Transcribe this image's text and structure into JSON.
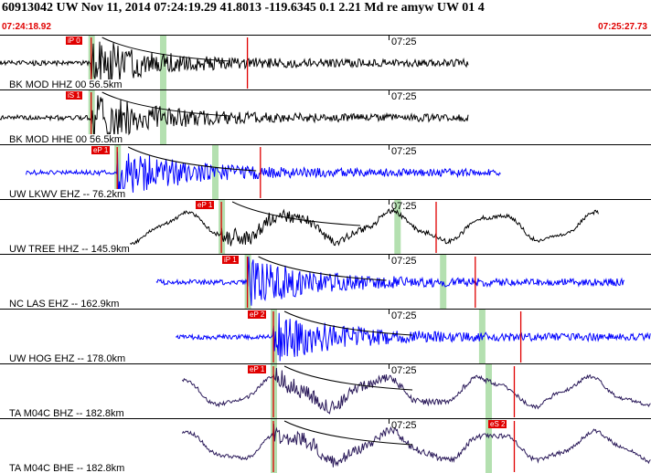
{
  "header": {
    "title": "60913042 UW Nov 11, 2014 07:24:19.29   41.8013 -119.6345  0.1 2.21 Md re amyw UW 01   4",
    "start_time": "07:24:18.92",
    "end_time": "07:25:27.73"
  },
  "tick_label": "07:25",
  "colors": {
    "trace_black": "#000000",
    "trace_blue": "#0000ff",
    "trace_purple": "#2b1a5a",
    "pick_box": "#e00000",
    "pick_line": "#e00000",
    "window": "#b4e0b0"
  },
  "panels": [
    {
      "label": "BK MOD HHZ 00 56.5km",
      "color": "#000000",
      "pick": "iP 0",
      "pick2": "",
      "style": "quake",
      "start": 0.0,
      "end": 0.72,
      "onset": 0.14,
      "green": [
        0.14,
        0.25
      ],
      "red": [
        0.38
      ]
    },
    {
      "label": "BK MOD HHE 00 56.5km",
      "color": "#000000",
      "pick": "iS 1",
      "pick2": "",
      "style": "quake",
      "start": 0.0,
      "end": 0.72,
      "onset": 0.14,
      "green": [
        0.14,
        0.25
      ],
      "red": []
    },
    {
      "label": "UW LKWV EHZ -- 76.2km",
      "color": "#0000ff",
      "pick": "eP 1",
      "pick2": "",
      "style": "quake",
      "start": 0.04,
      "end": 0.77,
      "onset": 0.18,
      "green": [
        0.18,
        0.33
      ],
      "red": [
        0.4
      ]
    },
    {
      "label": "UW TREE HHZ -- 145.9km",
      "color": "#000000",
      "pick": "eP 1",
      "pick2": "",
      "style": "wave",
      "start": 0.2,
      "end": 0.92,
      "onset": 0.34,
      "green": [
        0.34,
        0.61
      ],
      "red": [
        0.67
      ]
    },
    {
      "label": "NC LAS EHZ -- 162.9km",
      "color": "#0000ff",
      "pick": "iP 1",
      "pick2": "",
      "style": "quake",
      "start": 0.24,
      "end": 0.96,
      "onset": 0.38,
      "green": [
        0.38,
        0.68
      ],
      "red": [
        0.73
      ]
    },
    {
      "label": "UW HOG EHZ -- 178.0km",
      "color": "#0000ff",
      "pick": "eP 2",
      "pick2": "",
      "style": "quake",
      "start": 0.27,
      "end": 1.0,
      "onset": 0.42,
      "green": [
        0.42,
        0.74
      ],
      "red": [
        0.8
      ]
    },
    {
      "label": "TA M04C BHZ -- 182.8km",
      "color": "#2b1a5a",
      "pick": "eP 1",
      "pick2": "",
      "style": "wave",
      "start": 0.28,
      "end": 1.0,
      "onset": 0.42,
      "green": [
        0.42,
        0.75
      ],
      "red": [
        0.79
      ]
    },
    {
      "label": "TA M04C BHE -- 182.8km",
      "color": "#2b1a5a",
      "pick": "",
      "pick2": "eS 2",
      "style": "wave",
      "start": 0.28,
      "end": 1.0,
      "onset": 0.42,
      "green": [
        0.42,
        0.75
      ],
      "red": [
        0.79
      ]
    }
  ]
}
